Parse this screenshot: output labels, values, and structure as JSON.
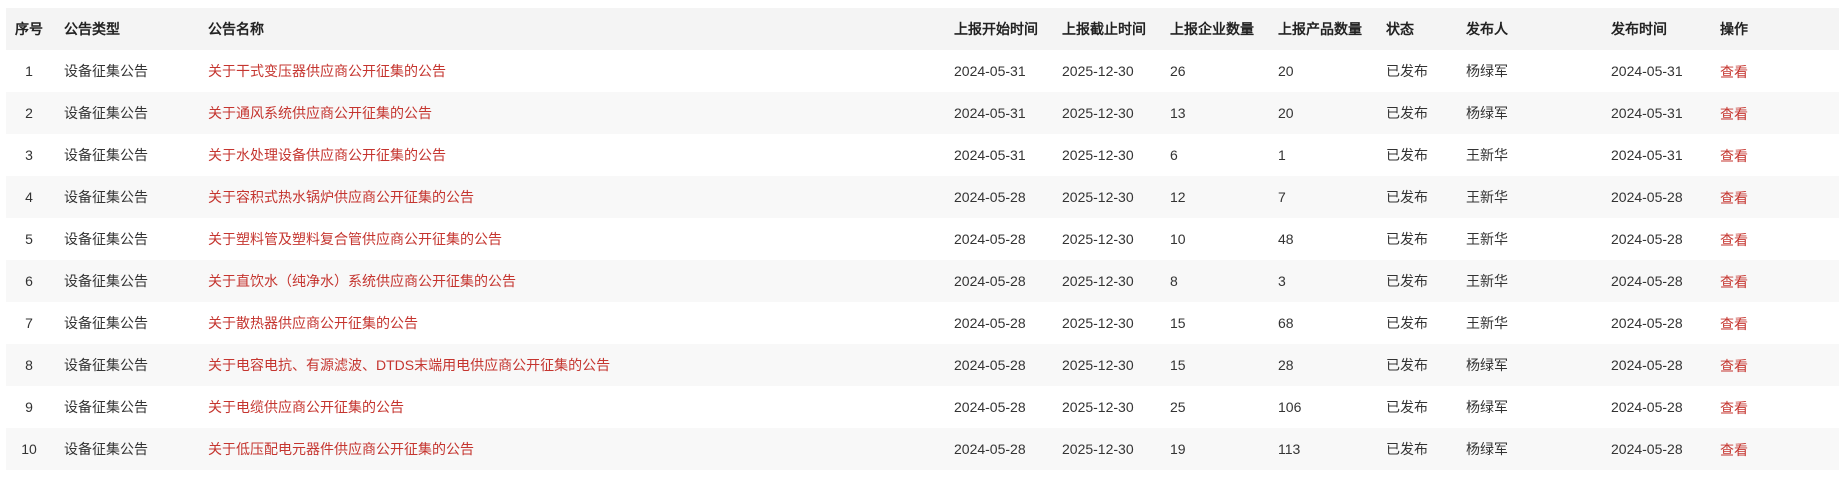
{
  "colors": {
    "link": "#c5352f",
    "header_bg": "#f4f4f4",
    "stripe_bg": "#f8f8f8",
    "text": "#333333"
  },
  "table": {
    "headers": [
      "序号",
      "公告类型",
      "公告名称",
      "上报开始时间",
      "上报截止时间",
      "上报企业数量",
      "上报产品数量",
      "状态",
      "发布人",
      "发布时间",
      "操作"
    ],
    "rows": [
      {
        "index": "1",
        "type": "设备征集公告",
        "name": "关于干式变压器供应商公开征集的公告",
        "start": "2024-05-31",
        "end": "2025-12-30",
        "companies": "26",
        "products": "20",
        "status": "已发布",
        "publisher": "杨绿军",
        "publish_time": "2024-05-31",
        "action": "查看"
      },
      {
        "index": "2",
        "type": "设备征集公告",
        "name": "关于通风系统供应商公开征集的公告",
        "start": "2024-05-31",
        "end": "2025-12-30",
        "companies": "13",
        "products": "20",
        "status": "已发布",
        "publisher": "杨绿军",
        "publish_time": "2024-05-31",
        "action": "查看"
      },
      {
        "index": "3",
        "type": "设备征集公告",
        "name": "关于水处理设备供应商公开征集的公告",
        "start": "2024-05-31",
        "end": "2025-12-30",
        "companies": "6",
        "products": "1",
        "status": "已发布",
        "publisher": "王新华",
        "publish_time": "2024-05-31",
        "action": "查看"
      },
      {
        "index": "4",
        "type": "设备征集公告",
        "name": "关于容积式热水锅炉供应商公开征集的公告",
        "start": "2024-05-28",
        "end": "2025-12-30",
        "companies": "12",
        "products": "7",
        "status": "已发布",
        "publisher": "王新华",
        "publish_time": "2024-05-28",
        "action": "查看"
      },
      {
        "index": "5",
        "type": "设备征集公告",
        "name": "关于塑料管及塑料复合管供应商公开征集的公告",
        "start": "2024-05-28",
        "end": "2025-12-30",
        "companies": "10",
        "products": "48",
        "status": "已发布",
        "publisher": "王新华",
        "publish_time": "2024-05-28",
        "action": "查看"
      },
      {
        "index": "6",
        "type": "设备征集公告",
        "name": "关于直饮水（纯净水）系统供应商公开征集的公告",
        "start": "2024-05-28",
        "end": "2025-12-30",
        "companies": "8",
        "products": "3",
        "status": "已发布",
        "publisher": "王新华",
        "publish_time": "2024-05-28",
        "action": "查看"
      },
      {
        "index": "7",
        "type": "设备征集公告",
        "name": "关于散热器供应商公开征集的公告",
        "start": "2024-05-28",
        "end": "2025-12-30",
        "companies": "15",
        "products": "68",
        "status": "已发布",
        "publisher": "王新华",
        "publish_time": "2024-05-28",
        "action": "查看"
      },
      {
        "index": "8",
        "type": "设备征集公告",
        "name": "关于电容电抗、有源滤波、DTDS末端用电供应商公开征集的公告",
        "start": "2024-05-28",
        "end": "2025-12-30",
        "companies": "15",
        "products": "28",
        "status": "已发布",
        "publisher": "杨绿军",
        "publish_time": "2024-05-28",
        "action": "查看"
      },
      {
        "index": "9",
        "type": "设备征集公告",
        "name": "关于电缆供应商公开征集的公告",
        "start": "2024-05-28",
        "end": "2025-12-30",
        "companies": "25",
        "products": "106",
        "status": "已发布",
        "publisher": "杨绿军",
        "publish_time": "2024-05-28",
        "action": "查看"
      },
      {
        "index": "10",
        "type": "设备征集公告",
        "name": "关于低压配电元器件供应商公开征集的公告",
        "start": "2024-05-28",
        "end": "2025-12-30",
        "companies": "19",
        "products": "113",
        "status": "已发布",
        "publisher": "杨绿军",
        "publish_time": "2024-05-28",
        "action": "查看"
      }
    ]
  }
}
